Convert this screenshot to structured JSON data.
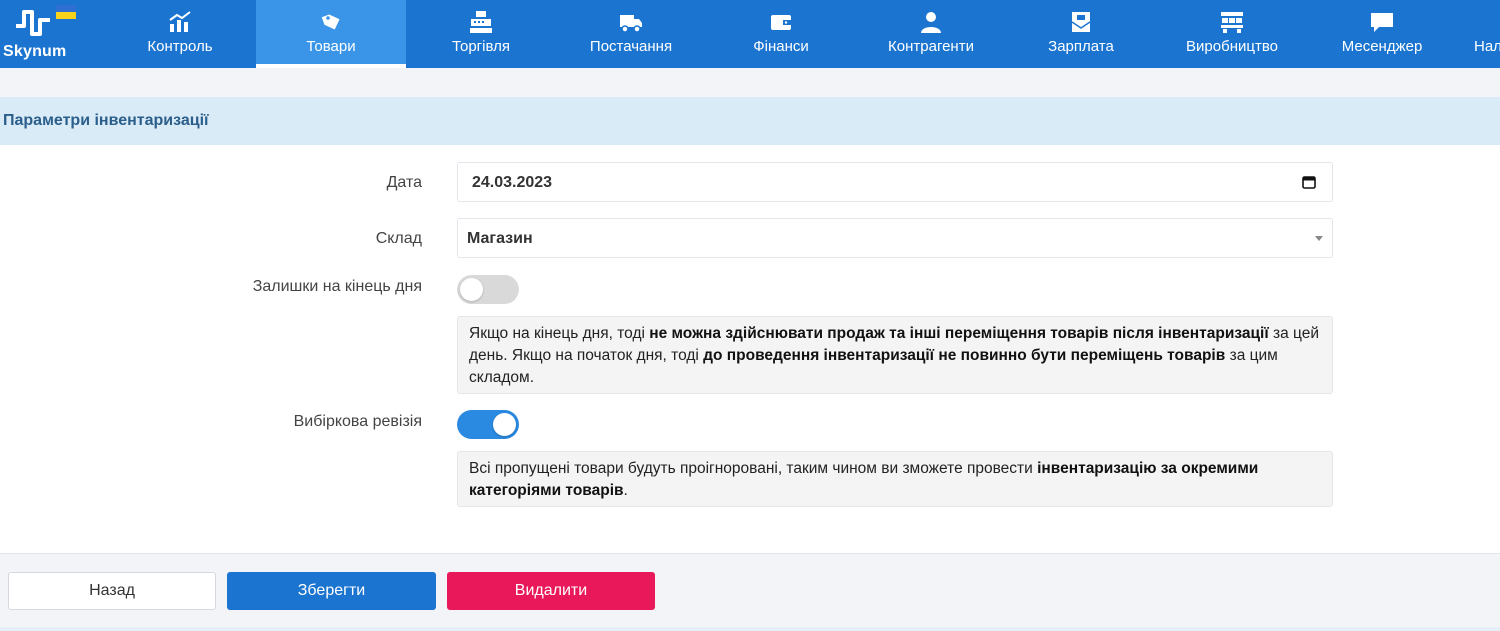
{
  "app": {
    "brand": "Skynum"
  },
  "nav": {
    "items": [
      {
        "label": "Контроль",
        "icon": "chart-up-icon"
      },
      {
        "label": "Товари",
        "icon": "tags-icon",
        "active": true
      },
      {
        "label": "Торгівля",
        "icon": "cash-register-icon"
      },
      {
        "label": "Постачання",
        "icon": "truck-icon"
      },
      {
        "label": "Фінанси",
        "icon": "wallet-icon"
      },
      {
        "label": "Контрагенти",
        "icon": "person-icon"
      },
      {
        "label": "Зарплата",
        "icon": "salary-envelope-icon"
      },
      {
        "label": "Виробництво",
        "icon": "factory-icon"
      },
      {
        "label": "Месенджер",
        "icon": "chat-icon"
      },
      {
        "label": "Нал",
        "icon": "settings-icon"
      }
    ],
    "accent": "#1b75d0",
    "active_color": "#3a95e8"
  },
  "section": {
    "title": "Параметри інвентаризації"
  },
  "form": {
    "date": {
      "label": "Дата",
      "value": "24.03.2023"
    },
    "warehouse": {
      "label": "Склад",
      "value": "Магазин"
    },
    "end_of_day": {
      "label": "Залишки на кінець дня",
      "enabled": false
    },
    "end_of_day_note": {
      "t1": "Якщо на кінець дня, тоді ",
      "b1": "не можна здійснювати продаж та інші переміщення товарів після інвентаризації",
      "t2": " за цей день. Якщо на початок дня, тоді ",
      "b2": "до проведення інвентаризації не повинно бути переміщень товарів",
      "t3": " за цим складом."
    },
    "selective": {
      "label": "Вибіркова ревізія",
      "enabled": true
    },
    "selective_note": {
      "t1": "Всі пропущені товари будуть проігноровані, таким чином ви зможете провести ",
      "b1": "інвентаризацію за окремими категоріями товарів",
      "t2": "."
    }
  },
  "footer": {
    "back_label": "Назад",
    "save_label": "Зберегти",
    "delete_label": "Видалити",
    "save_color": "#1b75d0",
    "delete_color": "#e8185a"
  }
}
